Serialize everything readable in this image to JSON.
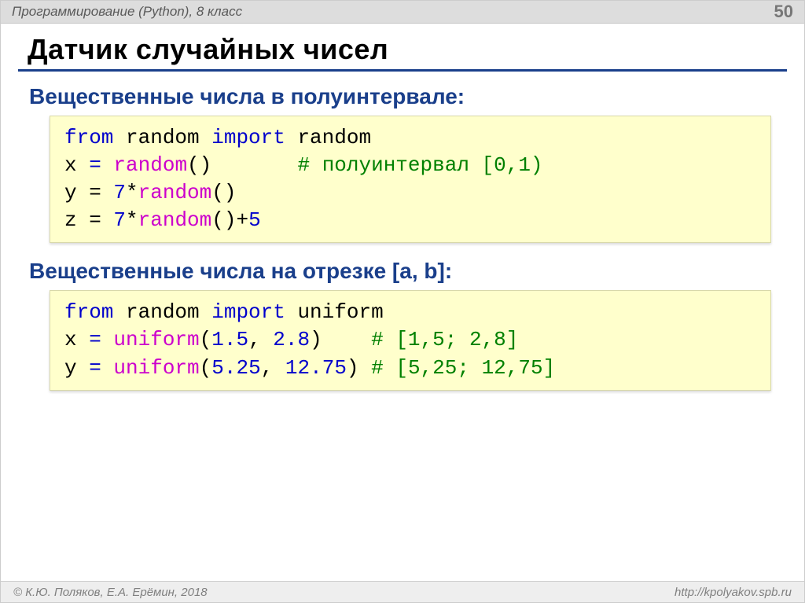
{
  "header": {
    "course": "Программирование (Python), 8 класс",
    "pagenum": "50"
  },
  "title": "Датчик случайных чисел",
  "section1": {
    "heading": "Вещественные числа в полуинтервале:",
    "code": {
      "l1": {
        "a": "from ",
        "b": "random ",
        "c": "import ",
        "d": "random"
      },
      "l2": {
        "a": "x ",
        "b": "=",
        "c": " random",
        "d": "()       ",
        "e": "# полуинтервал [0,1)"
      },
      "l3": {
        "a": "y = ",
        "b": "7",
        "c": "*",
        "d": "random",
        "e": "()"
      },
      "l4": {
        "a": "z = ",
        "b": "7",
        "c": "*",
        "d": "random",
        "e": "()",
        "f": "+",
        "g": "5"
      }
    }
  },
  "section2": {
    "heading": "Вещественные числа на отрезке [a, b]:",
    "code": {
      "l1": {
        "a": "from ",
        "b": "random ",
        "c": "import ",
        "d": "uniform"
      },
      "l2": {
        "a": "x ",
        "b": "=",
        "c": " uniform",
        "d": "(",
        "e": "1.5",
        "f": ", ",
        "g": "2.8",
        "h": ")    ",
        "i": "# [1,5; 2,8]"
      },
      "l3": {
        "a": "y ",
        "b": "=",
        "c": " uniform",
        "d": "(",
        "e": "5.25",
        "f": ", ",
        "g": "12.75",
        "h": ") ",
        "i": "# [5,25; 12,75]"
      }
    }
  },
  "footer": {
    "left": "© К.Ю. Поляков, Е.А. Ерёмин, 2018",
    "right": "http://kpolyakov.spb.ru"
  }
}
